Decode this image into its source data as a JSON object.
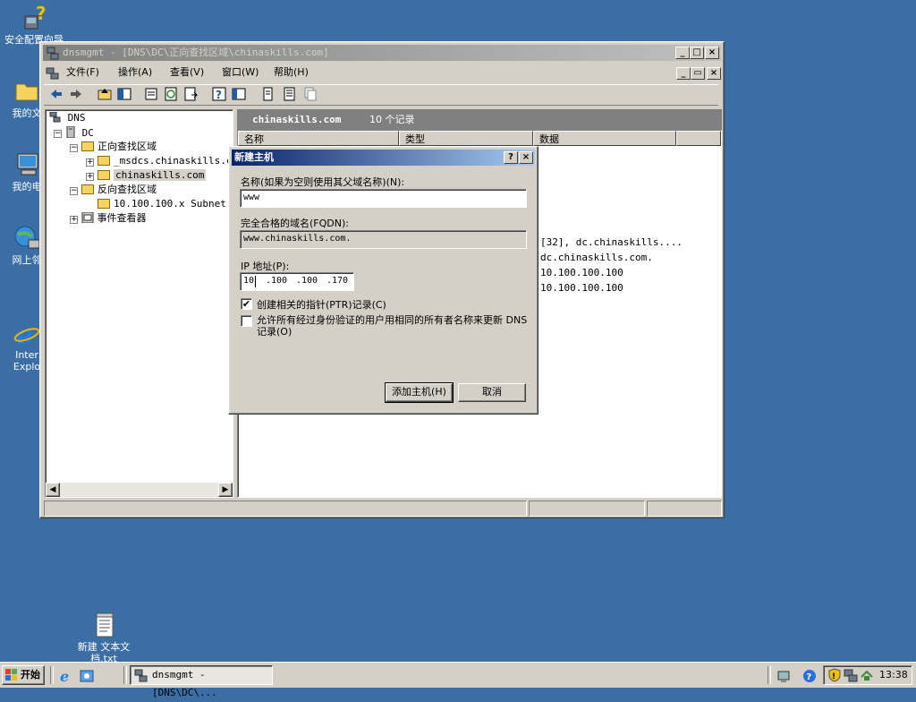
{
  "desktop": {
    "icons": [
      {
        "label": "安全配置向导",
        "icon": "security-wizard-icon"
      },
      {
        "label": "我的文",
        "icon": "my-documents-icon"
      },
      {
        "label": "我的电",
        "icon": "my-computer-icon"
      },
      {
        "label": "网上邻",
        "icon": "network-places-icon"
      },
      {
        "label": "Inter\nExplo",
        "icon": "internet-explorer-icon"
      },
      {
        "label": "新建 文本文\n档.txt",
        "icon": "text-file-icon"
      }
    ]
  },
  "mmc": {
    "title": "dnsmgmt - [DNS\\DC\\正向查找区域\\chinaskills.com]",
    "menu": [
      "文件(F)",
      "操作(A)",
      "查看(V)",
      "窗口(W)",
      "帮助(H)"
    ],
    "toolbar_icons": [
      "back-icon",
      "forward-icon",
      "up-level-icon",
      "show-hide-tree-icon",
      "properties-icon",
      "refresh-icon",
      "export-list-icon",
      "help-icon",
      "details-icon",
      "new-record-icon",
      "record-list-icon",
      "copy-icon"
    ],
    "tree": {
      "root": "DNS",
      "server": "DC",
      "forward_zones": "正向查找区域",
      "msdcs_zone": "_msdcs.chinaskills.cc",
      "selected_zone": "chinaskills.com",
      "reverse_zones": "反向查找区域",
      "reverse_subnet": "10.100.100.x Subnet",
      "event_viewer": "事件查看器"
    },
    "right_header": {
      "zone": "chinaskills.com",
      "count": "10 个记录"
    },
    "columns": [
      "名称",
      "类型",
      "数据"
    ],
    "visible_data": [
      "[32], dc.chinaskills....",
      "dc.chinaskills.com.",
      "10.100.100.100",
      "10.100.100.100"
    ]
  },
  "dialog": {
    "title": "新建主机",
    "name_label": "名称(如果为空则使用其父域名称)(N):",
    "name_value": "www",
    "fqdn_label": "完全合格的域名(FQDN):",
    "fqdn_value": "www.chinaskills.com.",
    "ip_label": "IP 地址(P):",
    "ip_octets": [
      "10",
      ".100",
      ".100",
      ".170"
    ],
    "ptr_label": "创建相关的指针(PTR)记录(C)",
    "ptr_checked": true,
    "auth_label": "允许所有经过身份验证的用户用相同的所有者名称来更新 DNS 记录(O)",
    "auth_checked": false,
    "add_button": "添加主机(H)",
    "cancel_button": "取消"
  },
  "taskbar": {
    "start_label": "开始",
    "task_label": "dnsmgmt - [DNS\\DC\\...",
    "clock": "13:38"
  },
  "colors": {
    "desktop": "#3a6ea5",
    "face": "#d4d0c8",
    "active_title_start": "#0a246a",
    "active_title_end": "#a6caf0",
    "header_bar": "#808080"
  }
}
